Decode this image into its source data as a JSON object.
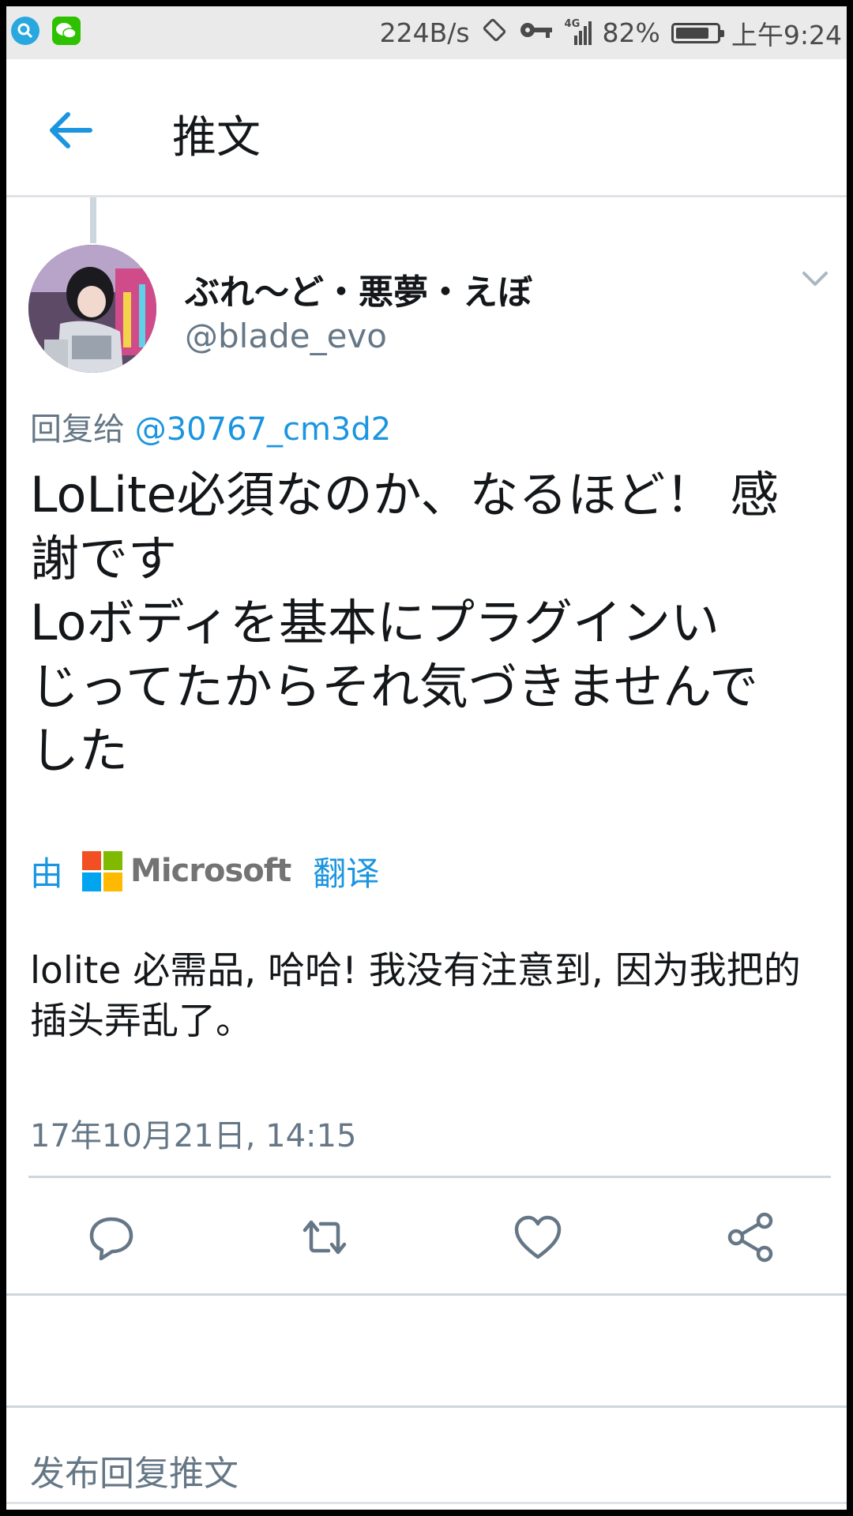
{
  "status_bar": {
    "net_speed": "224B/s",
    "signal": "4G",
    "battery": "82%",
    "battery_level": 0.82,
    "time": "上午9:24",
    "app_icons": [
      "search-app-icon",
      "wechat-icon"
    ],
    "colors": {
      "search_app": "#29a8e0",
      "wechat": "#2dc100"
    }
  },
  "header": {
    "title": "推文",
    "back_icon": "back-arrow-icon"
  },
  "tweet": {
    "display_name": "ぶれ〜ど・悪夢・えぼ",
    "handle": "@blade_evo",
    "reply_prefix": "回复给",
    "reply_mention": "@30767_cm3d2",
    "text": "LoLite必須なのか、なるほど！ 感\n謝です\nLoボディを基本にプラグインい\nじってたからそれ気づきませんで\nした",
    "translate": {
      "prefix": "由",
      "provider": "Microsoft",
      "suffix": "翻译"
    },
    "translation": "lolite 必需品, 哈哈! 我没有注意到, 因为我把的插头弄乱了。",
    "timestamp": "17年10月21日, 14:15"
  },
  "actions": [
    "reply-icon",
    "retweet-icon",
    "like-icon",
    "share-icon"
  ],
  "reply_box": {
    "placeholder": "发布回复推文"
  },
  "colors": {
    "accent": "#1b95e0",
    "text": "#14171a",
    "muted": "#657786",
    "divider": "#ccd6dd"
  }
}
